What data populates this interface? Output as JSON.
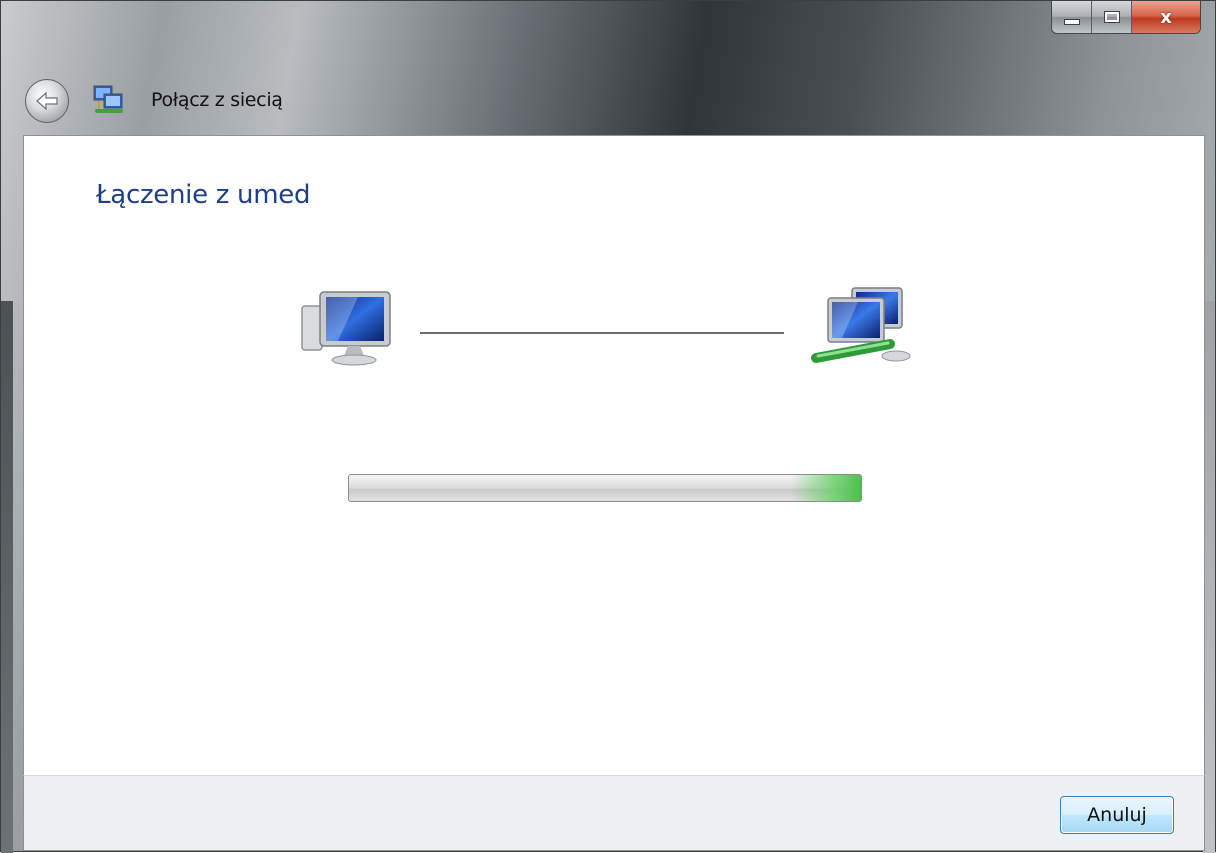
{
  "window": {
    "title": "Połącz z siecią",
    "controls": {
      "minimize_icon": "minimize-icon",
      "maximize_icon": "maximize-icon",
      "close_icon": "close-icon",
      "close_glyph": "x"
    }
  },
  "nav": {
    "back_icon": "back-arrow-icon",
    "app_icon": "network-connect-icon"
  },
  "main": {
    "heading": "Łączenie z umed",
    "local_icon": "computer-icon",
    "network_icon": "network-icon",
    "progress": {
      "state": "marquee",
      "indicator_color": "#5cd05c"
    }
  },
  "footer": {
    "cancel_label": "Anuluj"
  },
  "colors": {
    "heading": "#1f3f87",
    "button_border": "#3c7fb1"
  }
}
